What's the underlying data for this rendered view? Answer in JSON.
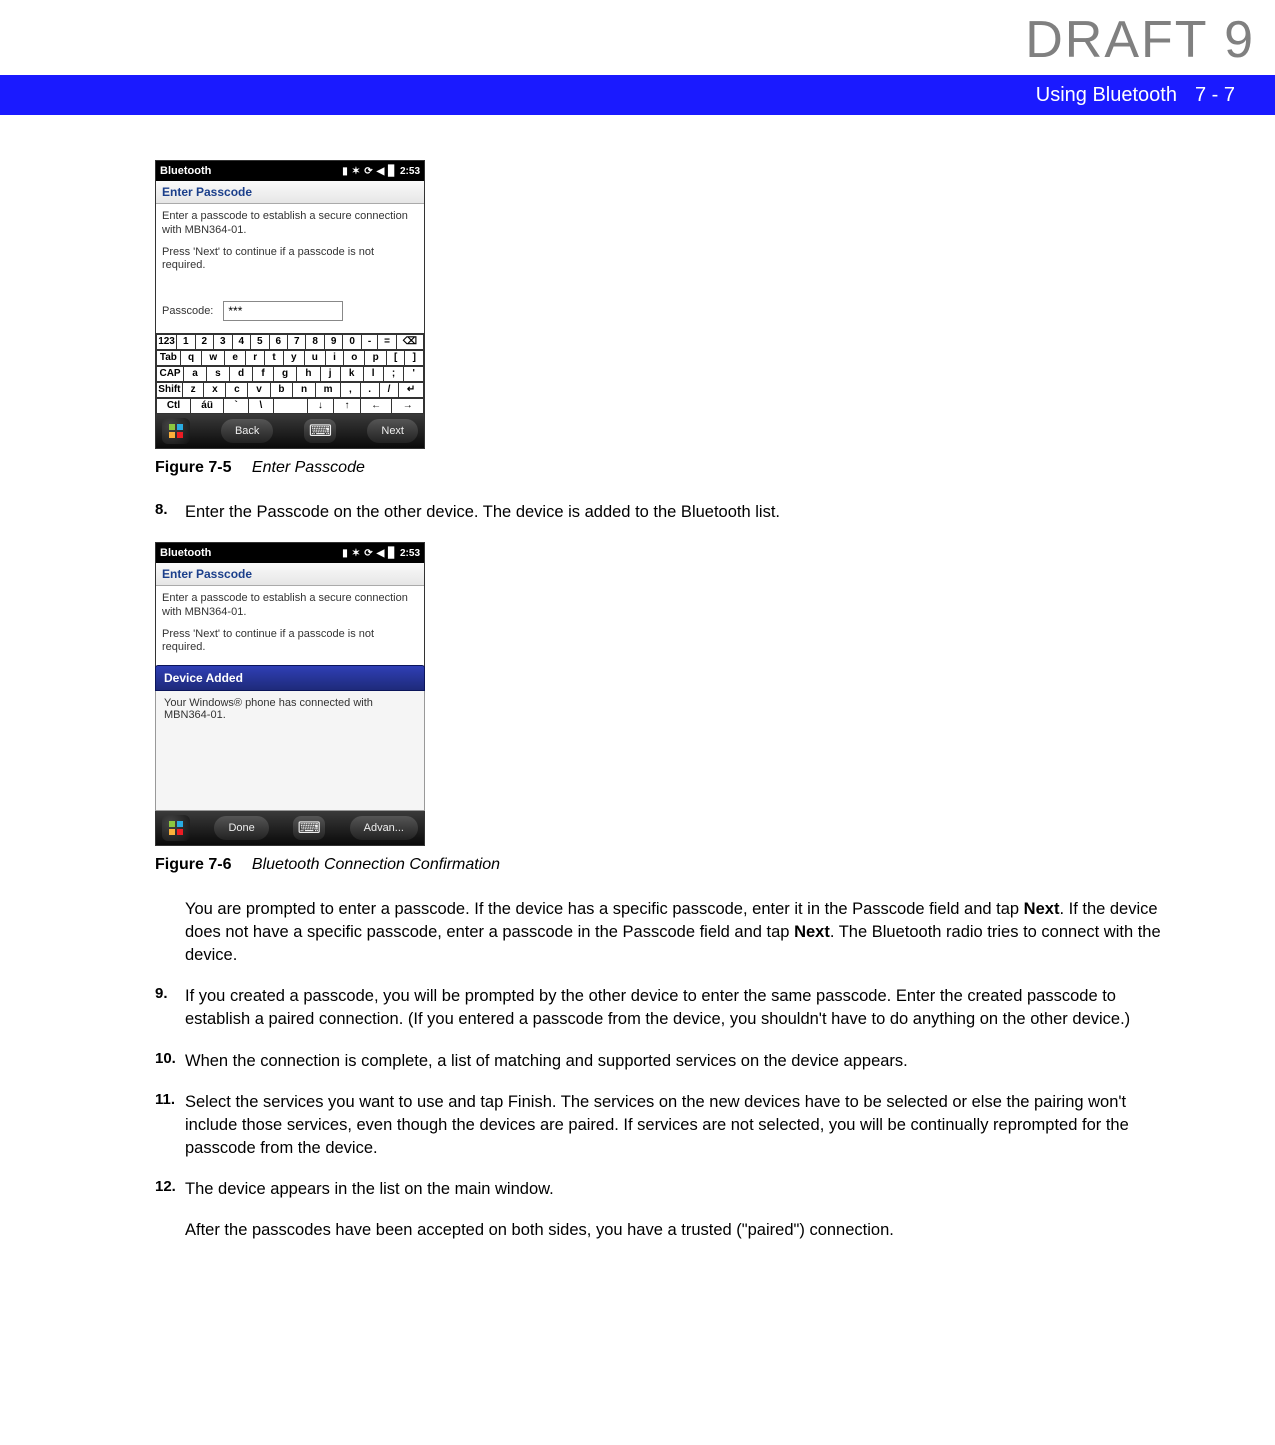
{
  "watermark": "DRAFT 9",
  "header": {
    "section": "Using Bluetooth",
    "page": "7 - 7"
  },
  "figure75": {
    "statusbar_title": "Bluetooth",
    "statusbar_time": "2:53",
    "titlebar": "Enter Passcode",
    "body_line1": "Enter a passcode to establish a secure connection with MBN364-01.",
    "body_line2": "Press 'Next' to continue if a passcode is not required.",
    "passcode_label": "Passcode:",
    "passcode_value": "***",
    "kb_row1": [
      "123",
      "1",
      "2",
      "3",
      "4",
      "5",
      "6",
      "7",
      "8",
      "9",
      "0",
      "-",
      "=",
      "⌫"
    ],
    "kb_row2": [
      "Tab",
      "q",
      "w",
      "e",
      "r",
      "t",
      "y",
      "u",
      "i",
      "o",
      "p",
      "[",
      "]"
    ],
    "kb_row3": [
      "CAP",
      "a",
      "s",
      "d",
      "f",
      "g",
      "h",
      "j",
      "k",
      "l",
      ";",
      "'"
    ],
    "kb_row4": [
      "Shift",
      "z",
      "x",
      "c",
      "v",
      "b",
      "n",
      "m",
      ",",
      ".",
      "/",
      "↵"
    ],
    "kb_row5": [
      "Ctl",
      "áü",
      "`",
      "\\",
      " ",
      "↓",
      "↑",
      "←",
      "→"
    ],
    "btn_back": "Back",
    "btn_next": "Next",
    "caption_num": "Figure 7-5",
    "caption_title": "Enter Passcode"
  },
  "step8": {
    "num": "8.",
    "text": "Enter the Passcode on the other device. The device is added to the Bluetooth list."
  },
  "figure76": {
    "statusbar_title": "Bluetooth",
    "statusbar_time": "2:53",
    "titlebar": "Enter Passcode",
    "body_line1": "Enter a passcode to establish a secure connection with MBN364-01.",
    "body_line2": "Press 'Next' to continue if a passcode is not required.",
    "popup_title": "Device Added",
    "popup_body": "Your Windows® phone has connected with MBN364-01.",
    "btn_done": "Done",
    "btn_advan": "Advan...",
    "caption_num": "Figure 7-6",
    "caption_title": "Bluetooth Connection Confirmation"
  },
  "para_after76": {
    "pre": "You are prompted to enter a passcode. If the device has a specific passcode, enter it in the Passcode field and tap ",
    "b1": "Next",
    "mid": ". If the device does not have a specific passcode, enter a passcode in the Passcode field and tap ",
    "b2": "Next",
    "post": ". The Bluetooth radio tries to connect with the device."
  },
  "step9": {
    "num": "9.",
    "text": "If you created a passcode, you will be prompted by the other device to enter the same passcode. Enter the created passcode to establish a paired connection. (If you entered a passcode from the device, you shouldn't have to do anything on the other device.)"
  },
  "step10": {
    "num": "10.",
    "text": "When the connection is complete, a list of matching and supported services on the device appears."
  },
  "step11": {
    "num": "11.",
    "text": "Select the services you want to use and tap Finish. The services on the new devices have to be selected or else the pairing won't include those services, even though the devices are paired. If services are not selected, you will be continually reprompted for the passcode from the device."
  },
  "step12": {
    "num": "12.",
    "text": "The device appears in the list on the main window."
  },
  "trailing": "After the passcodes have been accepted on both sides, you have a trusted (\"paired\") connection."
}
